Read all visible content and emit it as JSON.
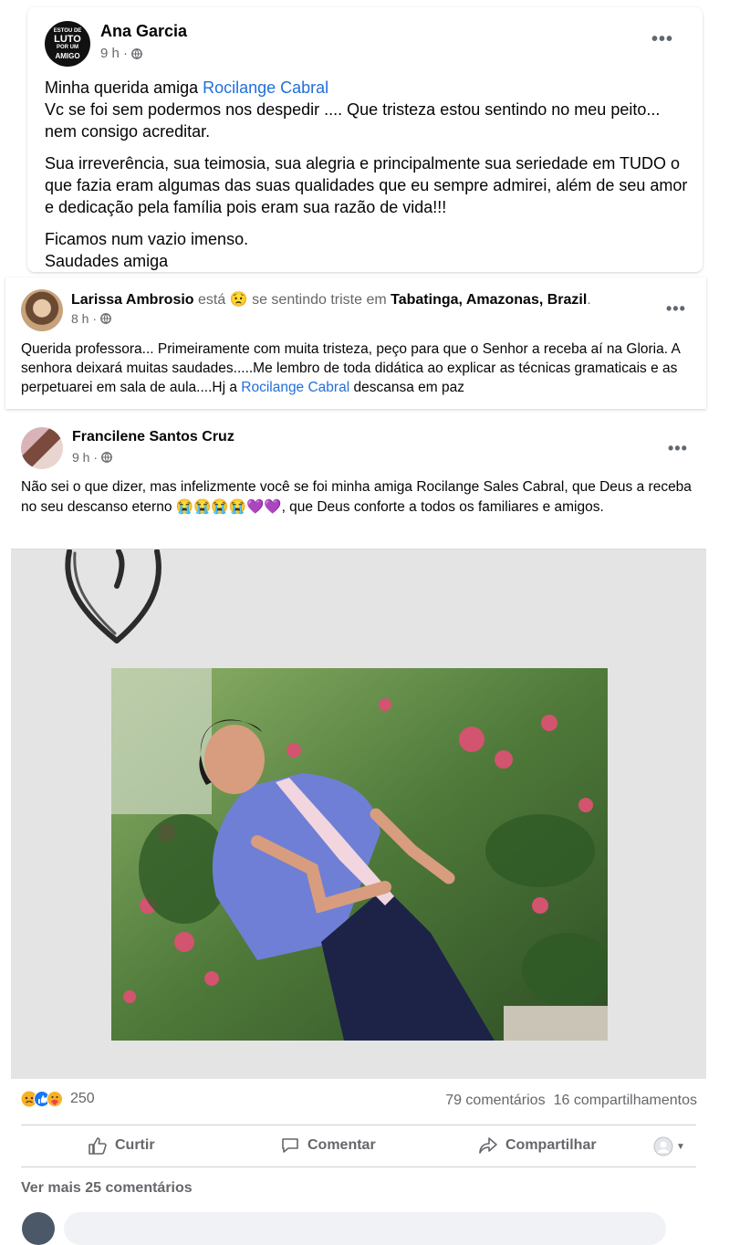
{
  "post1": {
    "author": "Ana Garcia",
    "avatar_text": [
      "ESTOU DE",
      "LUTO",
      "POR UM",
      "AMIGO"
    ],
    "time": "9 h ·",
    "options_icon": "more-options-icon",
    "line1_prefix": "Minha querida amiga ",
    "line1_link": "Rocilange Cabral",
    "para1": "Vc se foi sem podermos nos despedir .... Que tristeza estou sentindo no meu peito... nem consigo acreditar.",
    "para2": "Sua irreverência, sua teimosia, sua alegria e principalmente sua seriedade em TUDO o que fazia eram algumas das suas qualidades que eu sempre admirei, além de seu amor e dedicação pela família pois eram sua razão de vida!!!",
    "para3_line1": "Ficamos num vazio imenso.",
    "para3_line2": "Saudades amiga"
  },
  "post2": {
    "author": "Larissa Ambrosio",
    "feeling_prefix": " está ",
    "feeling_emoji": "😟",
    "feeling_text": " se sentindo triste em ",
    "location": "Tabatinga, Amazonas, Brazil",
    "location_suffix": ".",
    "time": "8 h ·",
    "text_prefix": "Querida professora... Primeiramente com muita tristeza, peço para que o Senhor a receba aí na Gloria. A senhora deixará muitas saudades.....Me lembro de toda didática ao explicar as técnicas gramaticais e as perpetuarei em sala de aula....Hj a ",
    "text_link": "Rocilange Cabral",
    "text_suffix": " descansa em paz"
  },
  "post3": {
    "author": "Francilene Santos Cruz",
    "time": "9 h ·",
    "text_prefix": "Não sei o que dizer, mas infelizmente você se foi minha amiga Rocilange Sales Cabral, que Deus a receba no seu descanso eterno ",
    "emojis": "😭😭😭😭💜💜",
    "text_suffix": ", que Deus conforte a todos os familiares e amigos."
  },
  "footer": {
    "reaction_count": "250",
    "comments": "79 comentários",
    "shares": "16 compartilhamentos",
    "like_label": "Curtir",
    "comment_label": "Comentar",
    "share_label": "Compartilhar",
    "more_comments": "Ver mais 25 comentários"
  },
  "colors": {
    "link": "#216fdb",
    "muted": "#65676b",
    "photo_bg": "#e4e4e4",
    "shirt": "#6f7fd6"
  }
}
